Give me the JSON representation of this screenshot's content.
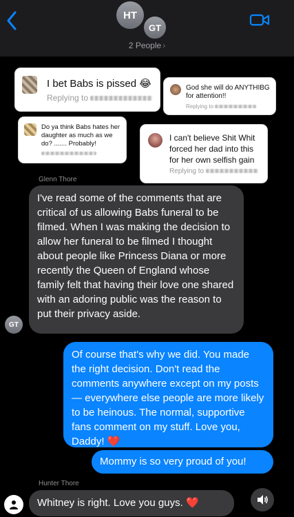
{
  "header": {
    "avatar_ht": "HT",
    "avatar_gt": "GT",
    "people_label": "2 People",
    "people_chevron": "›"
  },
  "cards": [
    {
      "text": "I bet Babs is pissed 😂",
      "reply": "Replying to"
    },
    {
      "text": "God she will do ANYTHIBG for attention!!",
      "reply": "Replying to"
    },
    {
      "text": "Do ya think Babs hates her daughter as much as we do? ....... Probably!"
    },
    {
      "text": "I can't believe Shit Whit forced her dad into this for her own selfish gain",
      "reply": "Replying to"
    }
  ],
  "messages": {
    "glenn_name": "Glenn Thore",
    "glenn_msg": "I've read some of the comments that are critical of us allowing Babs funeral to be filmed. When I was making the decision to allow her funeral to be filmed I thought about people like Princess Diana or more recently the Queen of England whose family felt that having their love one shared with an adoring public was the reason to put their privacy aside.",
    "glenn_avatar": "GT",
    "blue1": "Of course that's why we did. You made the right decision. Don't read the comments anywhere except on my posts — everywhere else people are more likely to be heinous. The normal, supportive fans comment on my stuff. Love you, Daddy!",
    "blue1_heart": "❤️",
    "blue2": "Mommy is so very proud of you!",
    "hunter_name": "Hunter Thore",
    "hunter_msg": "Whitney is right. Love you guys.",
    "hunter_heart": "❤️"
  },
  "colors": {
    "blue_bubble": "#0a84ff",
    "gray_bubble": "#3a3a3c",
    "accent": "#0a84ff"
  },
  "icons": [
    "back-chevron-icon",
    "video-camera-icon",
    "person-icon",
    "speaker-icon"
  ]
}
